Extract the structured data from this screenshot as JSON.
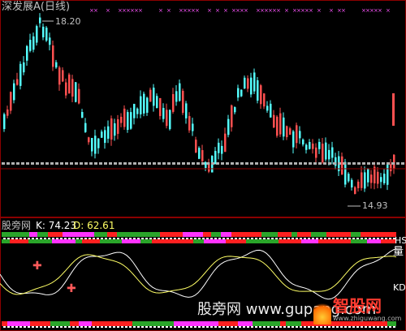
{
  "header": {
    "title": "深发展A(日线)",
    "title_color": "#c0c0c0"
  },
  "price_panel": {
    "high_label": "18.20",
    "low_label": "14.93",
    "label_color": "#c0c0c0",
    "up_color": "#ff5050",
    "down_color": "#54ffff",
    "marker_color": "#ff55ff"
  },
  "indicator_panel": {
    "name": "股旁网",
    "k_label": "K: 74.23",
    "d_label": "D: 62.61",
    "right_label_1": "HS",
    "right_label_2": "量",
    "right_label_3": "KD",
    "k_color": "#ffffff",
    "d_color": "#ffff66",
    "buy_marker_color": "#ff5a5a"
  },
  "watermark": {
    "text": "股旁网 www.gupang.com",
    "logo_text": "智股网",
    "logo_url_text": "www.zhiguwang.com"
  },
  "colors": {
    "grid": "#8b0000",
    "green": "#2aa52a",
    "red": "#ff2020",
    "magenta": "#ff33ff"
  }
}
